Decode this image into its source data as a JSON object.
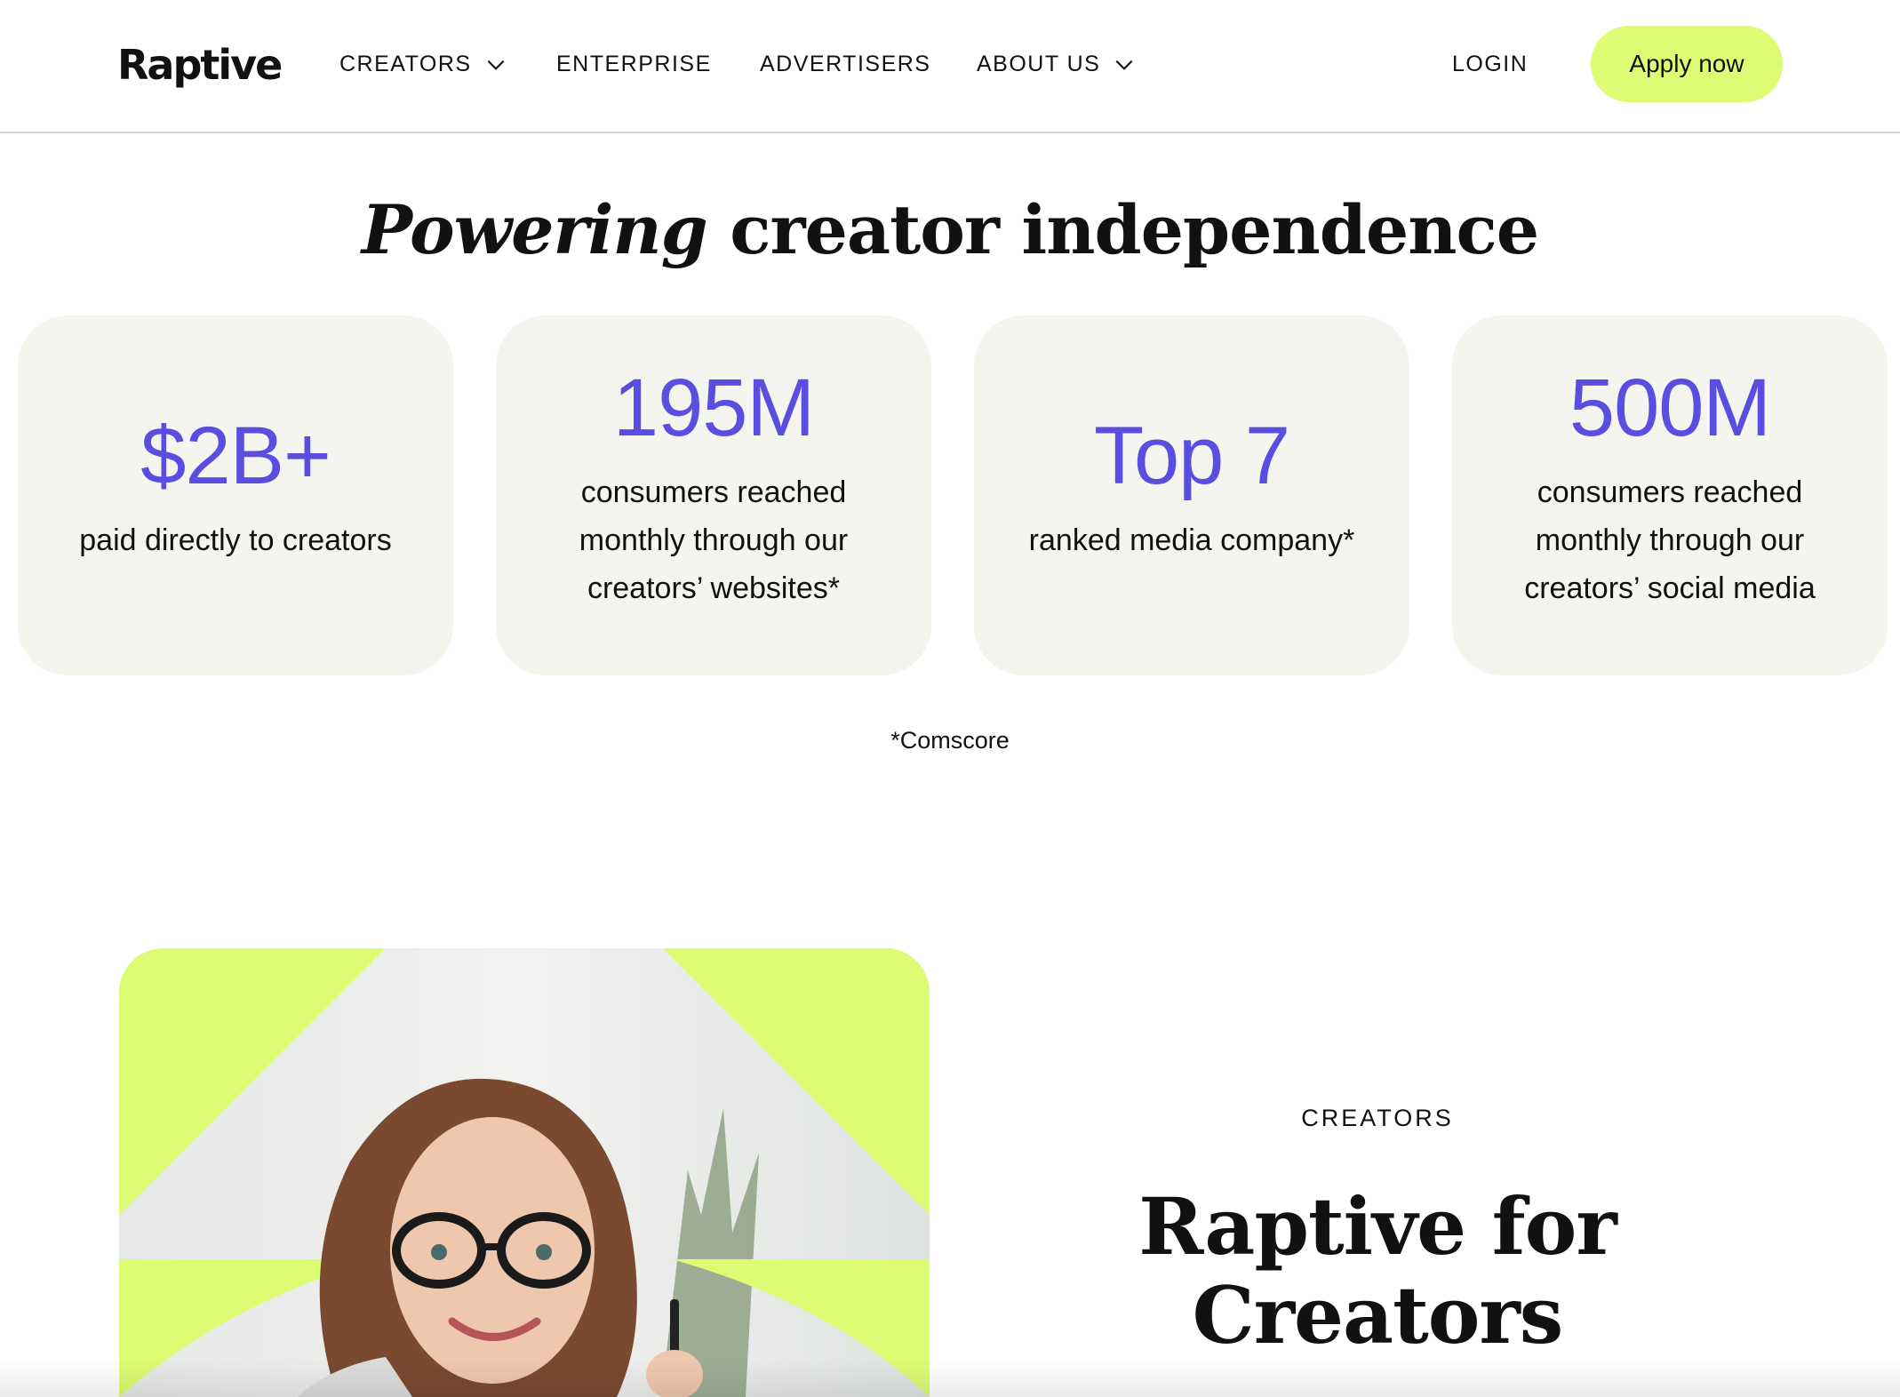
{
  "header": {
    "logo": "Raptive",
    "nav": {
      "creators": "CREATORS",
      "enterprise": "ENTERPRISE",
      "advertisers": "ADVERTISERS",
      "about": "ABOUT US"
    },
    "login": "LOGIN",
    "apply": "Apply now"
  },
  "hero": {
    "headline_italic": "Powering",
    "headline_rest": " creator independence"
  },
  "stats": [
    {
      "value": "$2B+",
      "description": "paid directly to creators"
    },
    {
      "value": "195M",
      "description": "consumers reached monthly through our creators’ websites*"
    },
    {
      "value": "Top 7",
      "description": "ranked media company*"
    },
    {
      "value": "500M",
      "description": "consumers reached monthly through our creators’ social media"
    }
  ],
  "footnote": "*Comscore",
  "creators_section": {
    "eyebrow": "CREATORS",
    "title_line1": "Raptive for",
    "title_line2": "Creators"
  },
  "colors": {
    "accent_purple": "#5a4ee0",
    "accent_lime": "#ddfb73",
    "card_bg": "#f5f5f0"
  },
  "icons": {
    "creators_dropdown": "chevron-down-icon",
    "about_dropdown": "chevron-down-icon"
  }
}
